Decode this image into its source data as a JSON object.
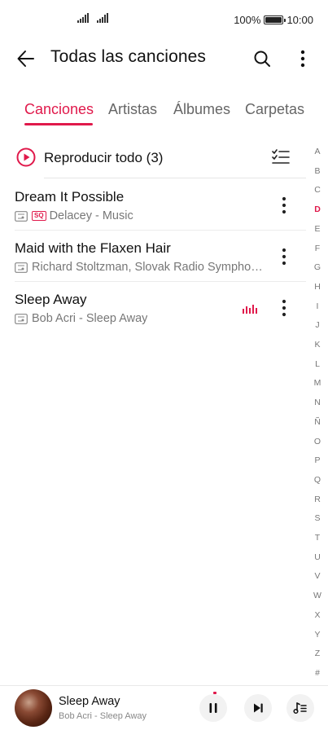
{
  "status_bar": {
    "battery_percent": "100%",
    "time": "10:00"
  },
  "header": {
    "title": "Todas las canciones",
    "back_icon": "back-arrow-icon",
    "search_icon": "search-icon",
    "more_icon": "more-vertical-icon"
  },
  "tabs": [
    {
      "label": "Canciones",
      "active": true
    },
    {
      "label": "Artistas",
      "active": false
    },
    {
      "label": "Álbumes",
      "active": false
    },
    {
      "label": "Carpetas",
      "active": false
    }
  ],
  "play_all": {
    "label": "Reproducir todo (3)"
  },
  "songs": [
    {
      "title": "Dream It Possible",
      "subtitle": "Delacey - Music",
      "badge": "SQ",
      "playing": false
    },
    {
      "title": "Maid with the Flaxen Hair",
      "subtitle": "Richard Stoltzman, Slovak Radio Symphon...",
      "badge": "",
      "playing": false
    },
    {
      "title": "Sleep Away",
      "subtitle": "Bob Acri - Sleep Away",
      "badge": "",
      "playing": true
    }
  ],
  "alphabet": {
    "letters": [
      "A",
      "B",
      "C",
      "D",
      "E",
      "F",
      "G",
      "H",
      "I",
      "J",
      "K",
      "L",
      "M",
      "N",
      "Ñ",
      "O",
      "P",
      "Q",
      "R",
      "S",
      "T",
      "U",
      "V",
      "W",
      "X",
      "Y",
      "Z",
      "#"
    ],
    "active": "D"
  },
  "now_playing": {
    "title": "Sleep Away",
    "subtitle": "Bob Acri - Sleep Away"
  },
  "colors": {
    "accent": "#e0194b",
    "text_primary": "#111111",
    "text_secondary": "#777777"
  }
}
